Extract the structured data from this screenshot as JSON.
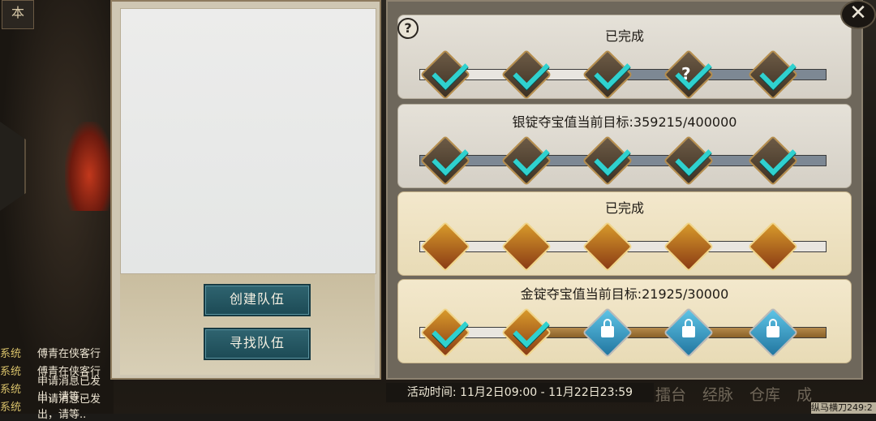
{
  "top_tag": "本",
  "team_panel": {
    "create_label": "创建队伍",
    "find_label": "寻找队伍"
  },
  "rows": [
    {
      "title": "已完成",
      "type": "silver",
      "fill": 0.45,
      "slots": [
        "check",
        "check",
        "check",
        "question-check",
        "check"
      ]
    },
    {
      "title": "银锭夺宝值当前目标:359215/400000",
      "type": "silver",
      "fill": 0.0,
      "slots": [
        "check",
        "check",
        "check",
        "check",
        "check"
      ]
    },
    {
      "title": "已完成",
      "type": "gold",
      "fill": 1.0,
      "slots": [
        "gold",
        "gold",
        "gold",
        "gold",
        "gold"
      ]
    },
    {
      "title": "金锭夺宝值当前目标:21925/30000",
      "type": "gold",
      "fill": 0.25,
      "slots": [
        "gold-check",
        "gold-check",
        "lock",
        "lock",
        "lock"
      ]
    }
  ],
  "activity_time": "活动时间: 11月2日09:00 - 11月22日23:59",
  "chat": [
    {
      "tag": "系统",
      "text": "傅青在侠客行"
    },
    {
      "tag": "系统",
      "text": "傅青在侠客行"
    },
    {
      "tag": "系统",
      "text": "申请消息已发出，请等.."
    },
    {
      "tag": "系统",
      "text": "申请消息已发出，请等.."
    }
  ],
  "bottom_nav": [
    "擂台",
    "经脉",
    "仓库",
    "成"
  ],
  "corner_text": "纵马横刀249:2"
}
